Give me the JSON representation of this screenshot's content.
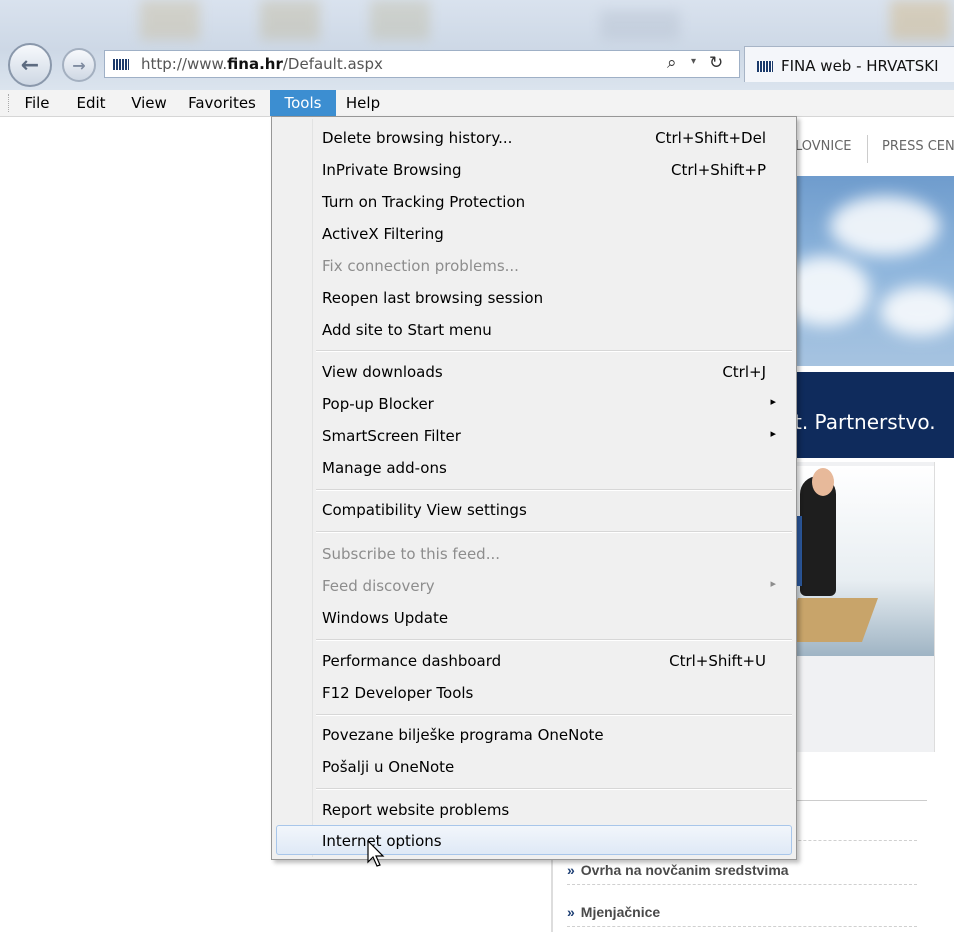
{
  "browser": {
    "url_prefix": "http://www.",
    "url_domain": "fina.hr",
    "url_suffix": "/Default.aspx",
    "tab_title": "FINA web - HRVATSKI",
    "icons": {
      "back": "back-arrow-icon",
      "forward": "forward-arrow-icon",
      "search": "search-icon",
      "refresh": "refresh-icon"
    }
  },
  "menubar": {
    "file": "File",
    "edit": "Edit",
    "view": "View",
    "favorites": "Favorites",
    "tools": "Tools",
    "help": "Help",
    "active": "Tools",
    "active_color": "#3c8ed1"
  },
  "tools_menu": {
    "items": [
      {
        "label": "Delete browsing history...",
        "shortcut": "Ctrl+Shift+Del"
      },
      {
        "label": "InPrivate Browsing",
        "shortcut": "Ctrl+Shift+P"
      },
      {
        "label": "Turn on Tracking Protection"
      },
      {
        "label": "ActiveX Filtering"
      },
      {
        "label": "Fix connection problems...",
        "disabled": true
      },
      {
        "label": "Reopen last browsing session"
      },
      {
        "label": "Add site to Start menu"
      },
      {
        "label": "View downloads",
        "shortcut": "Ctrl+J"
      },
      {
        "label": "Pop-up Blocker",
        "submenu": true
      },
      {
        "label": "SmartScreen Filter",
        "submenu": true
      },
      {
        "label": "Manage add-ons"
      },
      {
        "label": "Compatibility View settings"
      },
      {
        "label": "Subscribe to this feed...",
        "disabled": true
      },
      {
        "label": "Feed discovery",
        "disabled": true,
        "submenu": true
      },
      {
        "label": "Windows Update"
      },
      {
        "label": "Performance dashboard",
        "shortcut": "Ctrl+Shift+U"
      },
      {
        "label": "F12 Developer Tools"
      },
      {
        "label": "Povezane bilješke programa OneNote"
      },
      {
        "label": "Pošalji u OneNote"
      },
      {
        "label": "Report website problems"
      },
      {
        "label": "Internet options",
        "highlighted": true
      }
    ],
    "submenu_glyph": "▸"
  },
  "webpage": {
    "nav_item_1": "LOVNICE",
    "nav_item_2": "PRESS CEN",
    "slogan": "t. Partnerstvo.",
    "links": [
      {
        "text": "da"
      },
      {
        "text": "Ovrha na novčanim sredstvima"
      },
      {
        "text": "Mjenjačnice"
      }
    ],
    "link_chevron": "»"
  }
}
